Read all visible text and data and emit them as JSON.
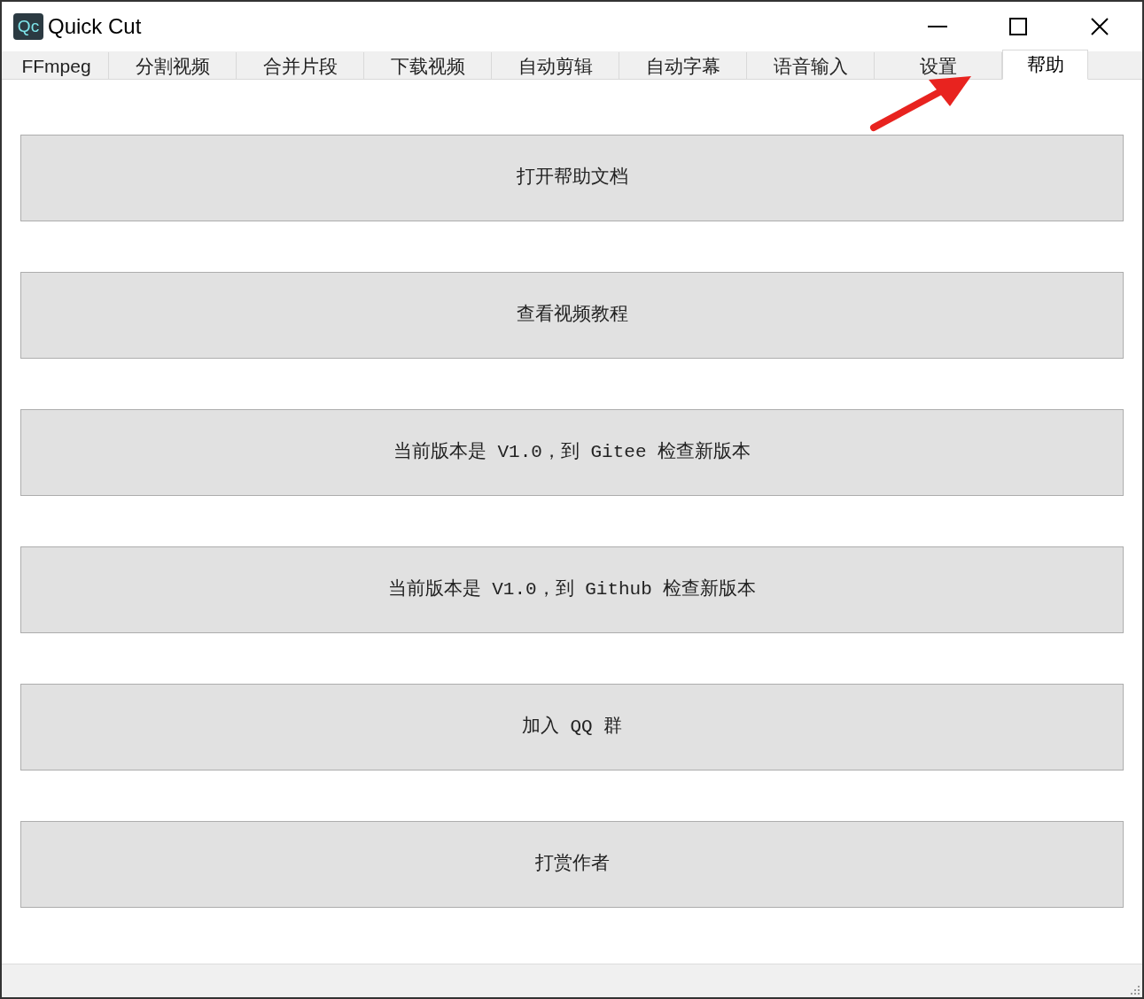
{
  "window": {
    "title": "Quick Cut",
    "logo": "Qc"
  },
  "tabs": [
    {
      "label": "FFmpeg",
      "selected": false
    },
    {
      "label": "分割视频",
      "selected": false
    },
    {
      "label": "合并片段",
      "selected": false
    },
    {
      "label": "下载视频",
      "selected": false
    },
    {
      "label": "自动剪辑",
      "selected": false
    },
    {
      "label": "自动字幕",
      "selected": false
    },
    {
      "label": "语音输入",
      "selected": false
    },
    {
      "label": "设置",
      "selected": false
    },
    {
      "label": "帮助",
      "selected": true
    }
  ],
  "buttons": [
    "打开帮助文档",
    "查看视频教程",
    "当前版本是 V1.0，到 Gitee 检查新版本",
    "当前版本是 V1.0，到 Github 检查新版本",
    "加入 QQ 群",
    "打赏作者"
  ]
}
